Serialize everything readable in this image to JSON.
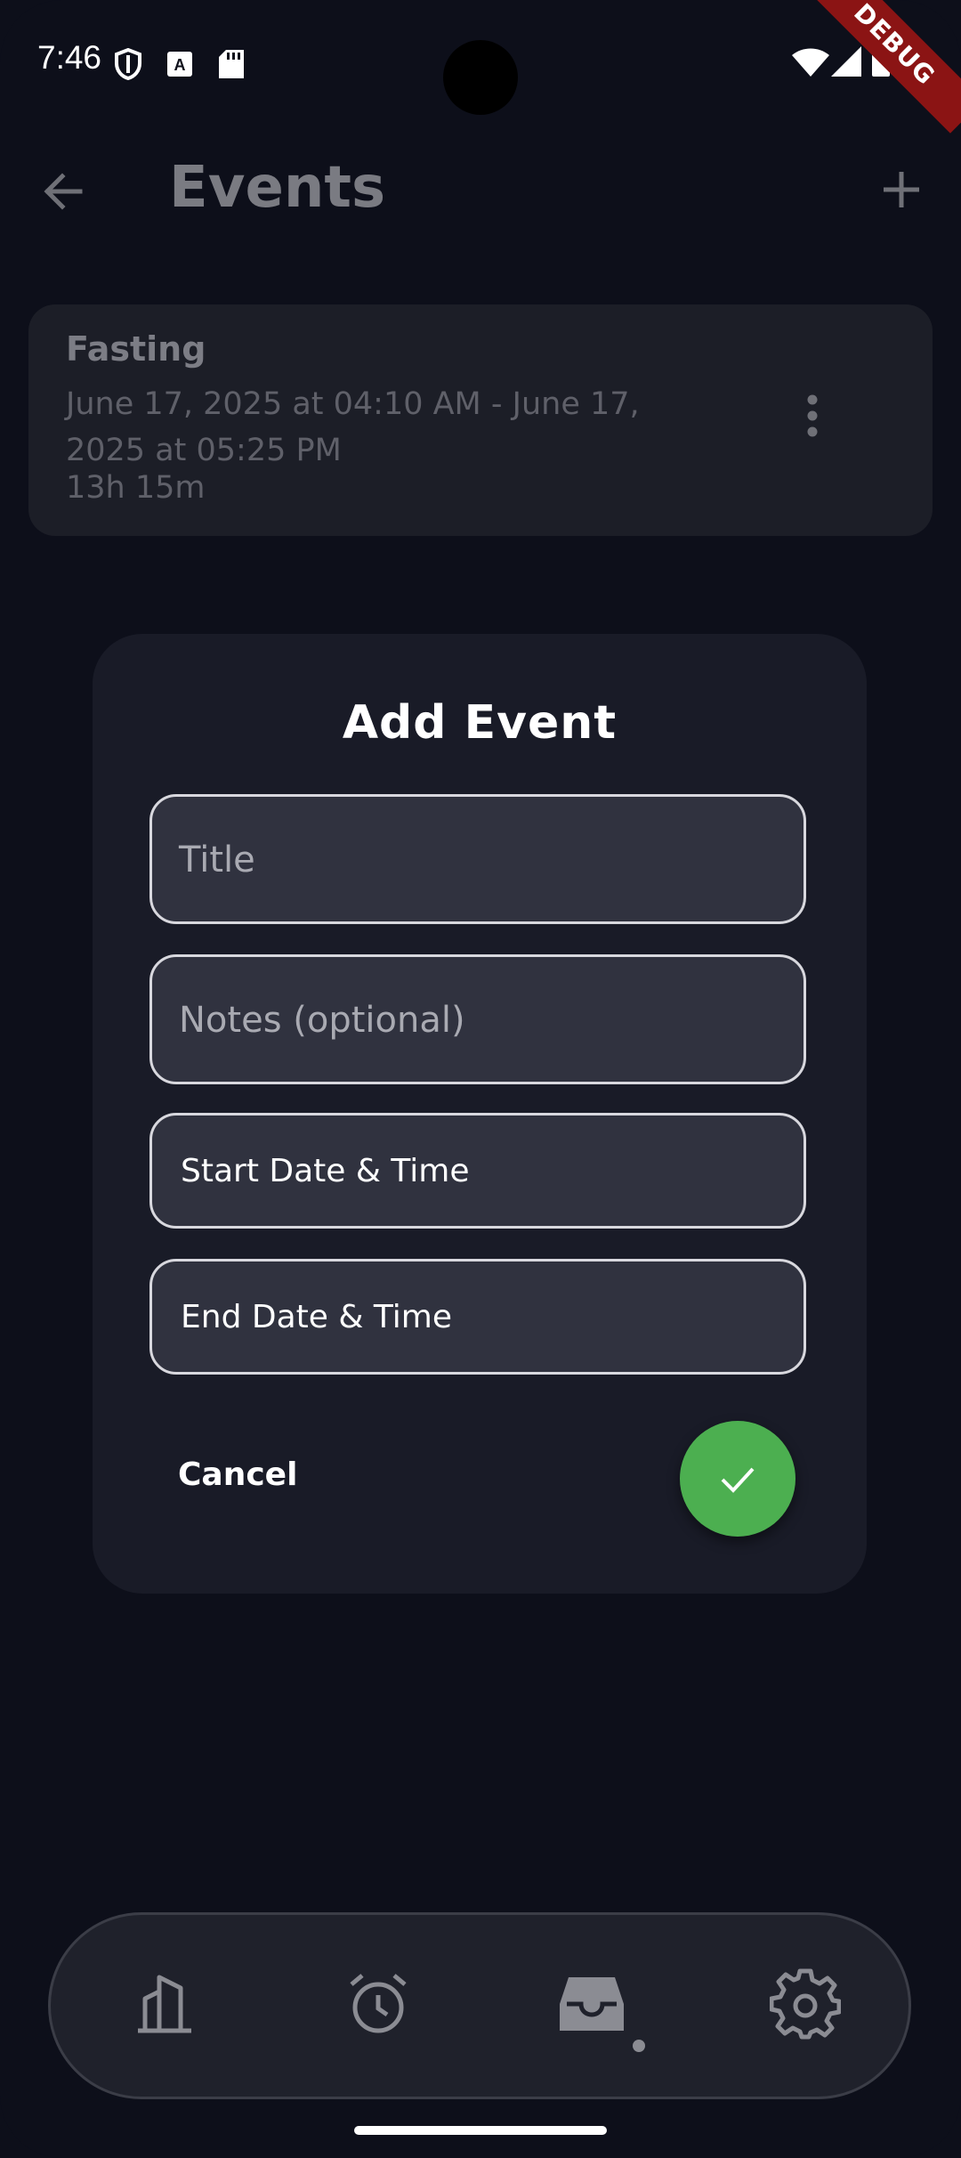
{
  "status_bar": {
    "time": "7:46",
    "debug_label": "DEBUG"
  },
  "app_bar": {
    "title": "Events"
  },
  "events": [
    {
      "name": "Fasting",
      "dates": "June 17, 2025 at 04:10 AM - June 17, 2025 at 05:25 PM",
      "duration": "13h 15m"
    }
  ],
  "dialog": {
    "title": "Add Event",
    "title_placeholder": "Title",
    "notes_placeholder": "Notes (optional)",
    "start_label": "Start Date & Time",
    "end_label": "End Date & Time",
    "cancel_label": "Cancel",
    "confirm_icon": "check-icon",
    "confirm_color": "#4caf50"
  },
  "bottom_nav": {
    "items": [
      "stats-icon",
      "alarm-icon",
      "inbox-icon",
      "settings-icon"
    ],
    "active_index": 2
  }
}
